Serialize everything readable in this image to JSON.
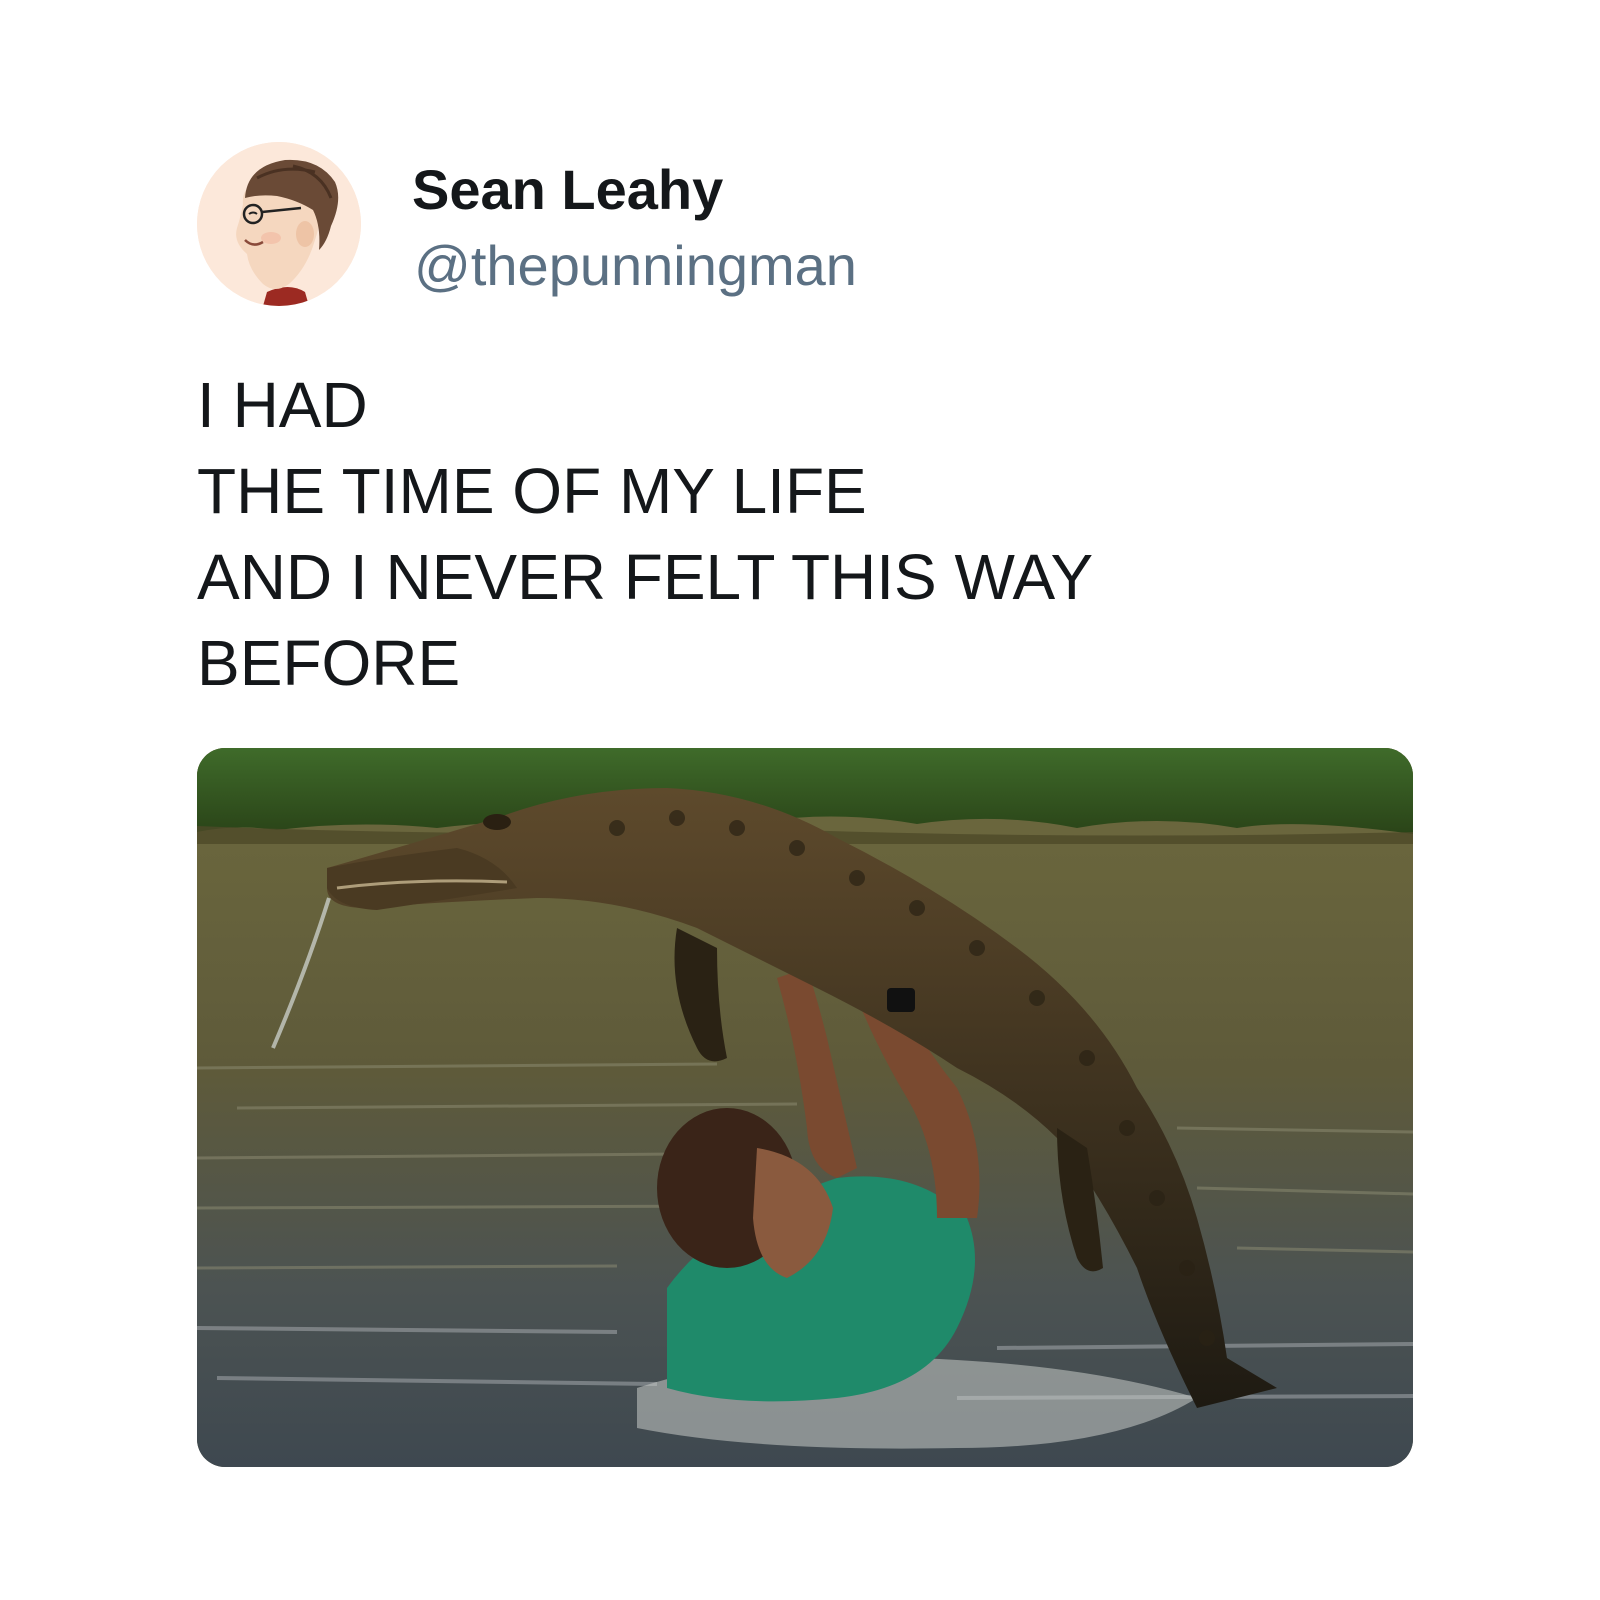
{
  "author": {
    "display_name": "Sean Leahy",
    "handle": "@thepunningman",
    "avatar_icon": "cartoon-portrait-avatar"
  },
  "tweet": {
    "lines": [
      "I HAD",
      "THE TIME OF MY LIFE",
      "AND I NEVER FELT THIS WAY",
      "BEFORE"
    ]
  },
  "media": {
    "icon": "man-lifting-alligator-in-river-photo"
  },
  "colors": {
    "background": "#ffffff",
    "name_text": "#14171a",
    "handle_text": "#5b7083",
    "body_text": "#14171a",
    "avatar_bg": "#fce8da"
  }
}
